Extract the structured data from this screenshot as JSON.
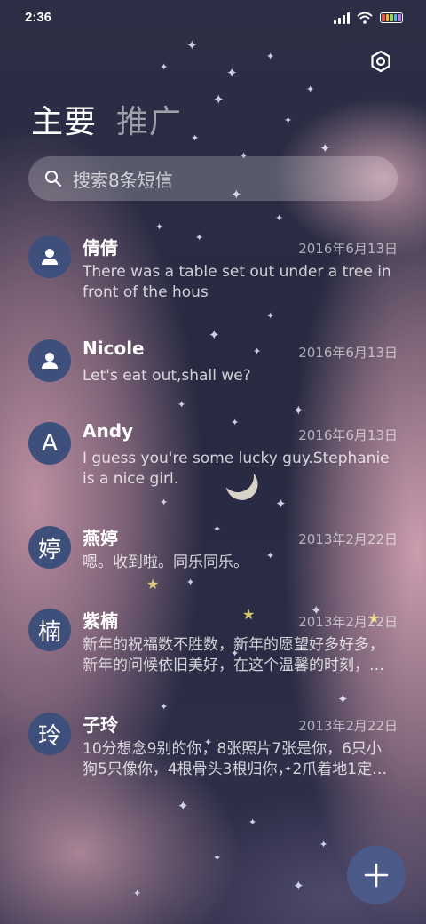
{
  "status_bar": {
    "time": "2:36"
  },
  "tabs": [
    {
      "label": "主要",
      "active": true
    },
    {
      "label": "推广",
      "active": false
    }
  ],
  "search": {
    "placeholder": "搜索8条短信"
  },
  "conversations": [
    {
      "name": "倩倩",
      "date": "2016年6月13日",
      "preview": "There was a table set out under a tree in front of the hous",
      "avatar": "person-icon"
    },
    {
      "name": "Nicole",
      "date": "2016年6月13日",
      "preview": "Let's eat out,shall we?",
      "avatar": "person-icon"
    },
    {
      "name": "Andy",
      "date": "2016年6月13日",
      "preview": "I guess you're some lucky guy.Stephanie is a nice girl.",
      "avatar_text": "A"
    },
    {
      "name": "燕婷",
      "date": "2013年2月22日",
      "preview": "嗯。收到啦。同乐同乐。",
      "avatar_text": "婷"
    },
    {
      "name": "紫楠",
      "date": "2013年2月22日",
      "preview": "新年的祝福数不胜数，新年的愿望好多好多，新年的问候依旧美好，在这个温馨的时刻，…",
      "avatar_text": "楠"
    },
    {
      "name": "子玲",
      "date": "2013年2月22日",
      "preview": "10分想念9别的你，8张照片7张是你，6只小狗5只像你，4根骨头3根归你，2爪着地1定…",
      "avatar_text": "玲"
    }
  ],
  "colors": {
    "avatar_bg": "#3f4f7c",
    "fab_bg": "#4b5a89"
  },
  "icons": {
    "settings": "gear-icon",
    "search": "search-icon",
    "compose": "plus-icon"
  }
}
